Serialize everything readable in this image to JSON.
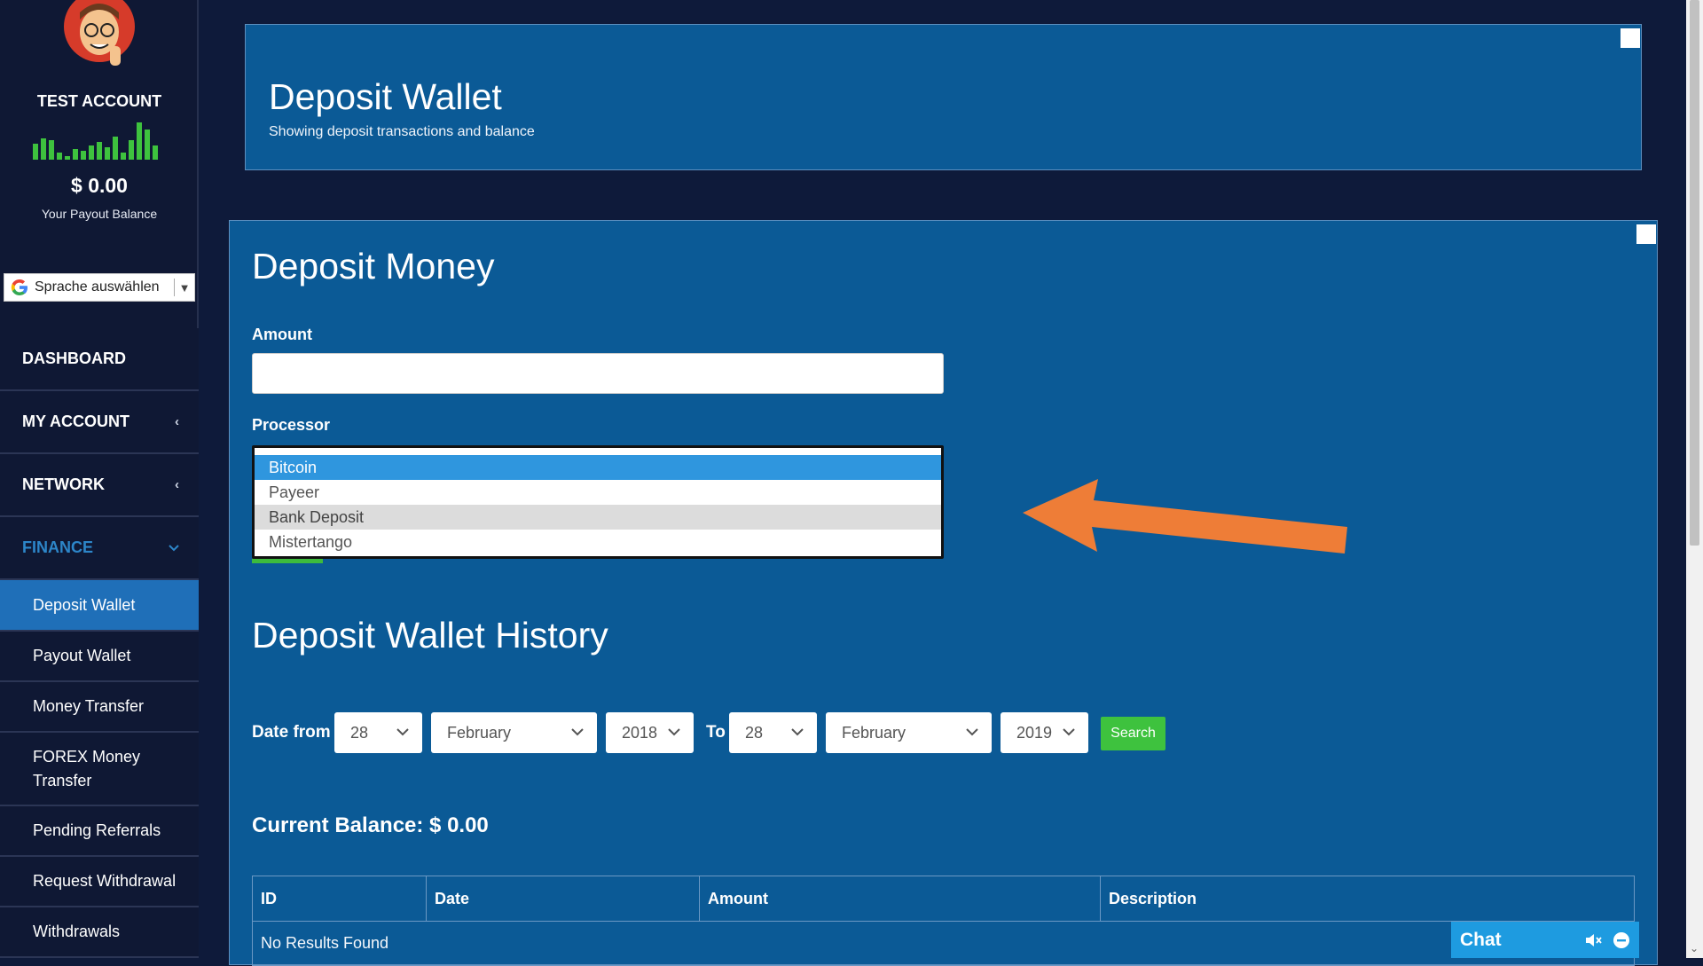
{
  "sidebar": {
    "account_name": "TEST ACCOUNT",
    "balance": "$ 0.00",
    "balance_caption": "Your Payout Balance",
    "translate_label": "Sprache auswählen",
    "nav": [
      {
        "label": "DASHBOARD"
      },
      {
        "label": "MY ACCOUNT"
      },
      {
        "label": "NETWORK"
      },
      {
        "label": "FINANCE"
      }
    ],
    "finance_items": [
      {
        "label": "Deposit Wallet"
      },
      {
        "label": "Payout Wallet"
      },
      {
        "label": "Money Transfer"
      },
      {
        "label": "FOREX Money Transfer"
      },
      {
        "label": "Pending Referrals"
      },
      {
        "label": "Request Withdrawal"
      },
      {
        "label": "Withdrawals"
      }
    ]
  },
  "header": {
    "title": "Deposit Wallet",
    "subtitle": "Showing deposit transactions and balance"
  },
  "deposit": {
    "title": "Deposit Money",
    "amount_label": "Amount",
    "amount_value": "",
    "processor_label": "Processor",
    "processor_options": [
      "Bitcoin",
      "Payeer",
      "Bank Deposit",
      "Mistertango"
    ],
    "selected_option": "Bitcoin"
  },
  "history": {
    "title": "Deposit Wallet History",
    "date_from_label": "Date from",
    "to_label": "To",
    "from_day": "28",
    "from_month": "February",
    "from_year": "2018",
    "to_day": "28",
    "to_month": "February",
    "to_year": "2019",
    "search_label": "Search",
    "current_balance": "Current Balance: $ 0.00",
    "columns": [
      "ID",
      "Date",
      "Amount",
      "Description"
    ],
    "empty_text": "No Results Found"
  },
  "chat": {
    "label": "Chat"
  },
  "colors": {
    "panel": "#0b5a96",
    "accent": "#1f6fb8",
    "sidebar": "#0f1834",
    "annotation_arrow": "#ee7d37",
    "success": "#3ec23e"
  },
  "icons": [
    "avatar",
    "bars-chart-icon",
    "google-g-icon",
    "chevron-left-icon",
    "chevron-down-icon",
    "arrow-annotation-icon",
    "mute-icon",
    "minimize-icon"
  ]
}
